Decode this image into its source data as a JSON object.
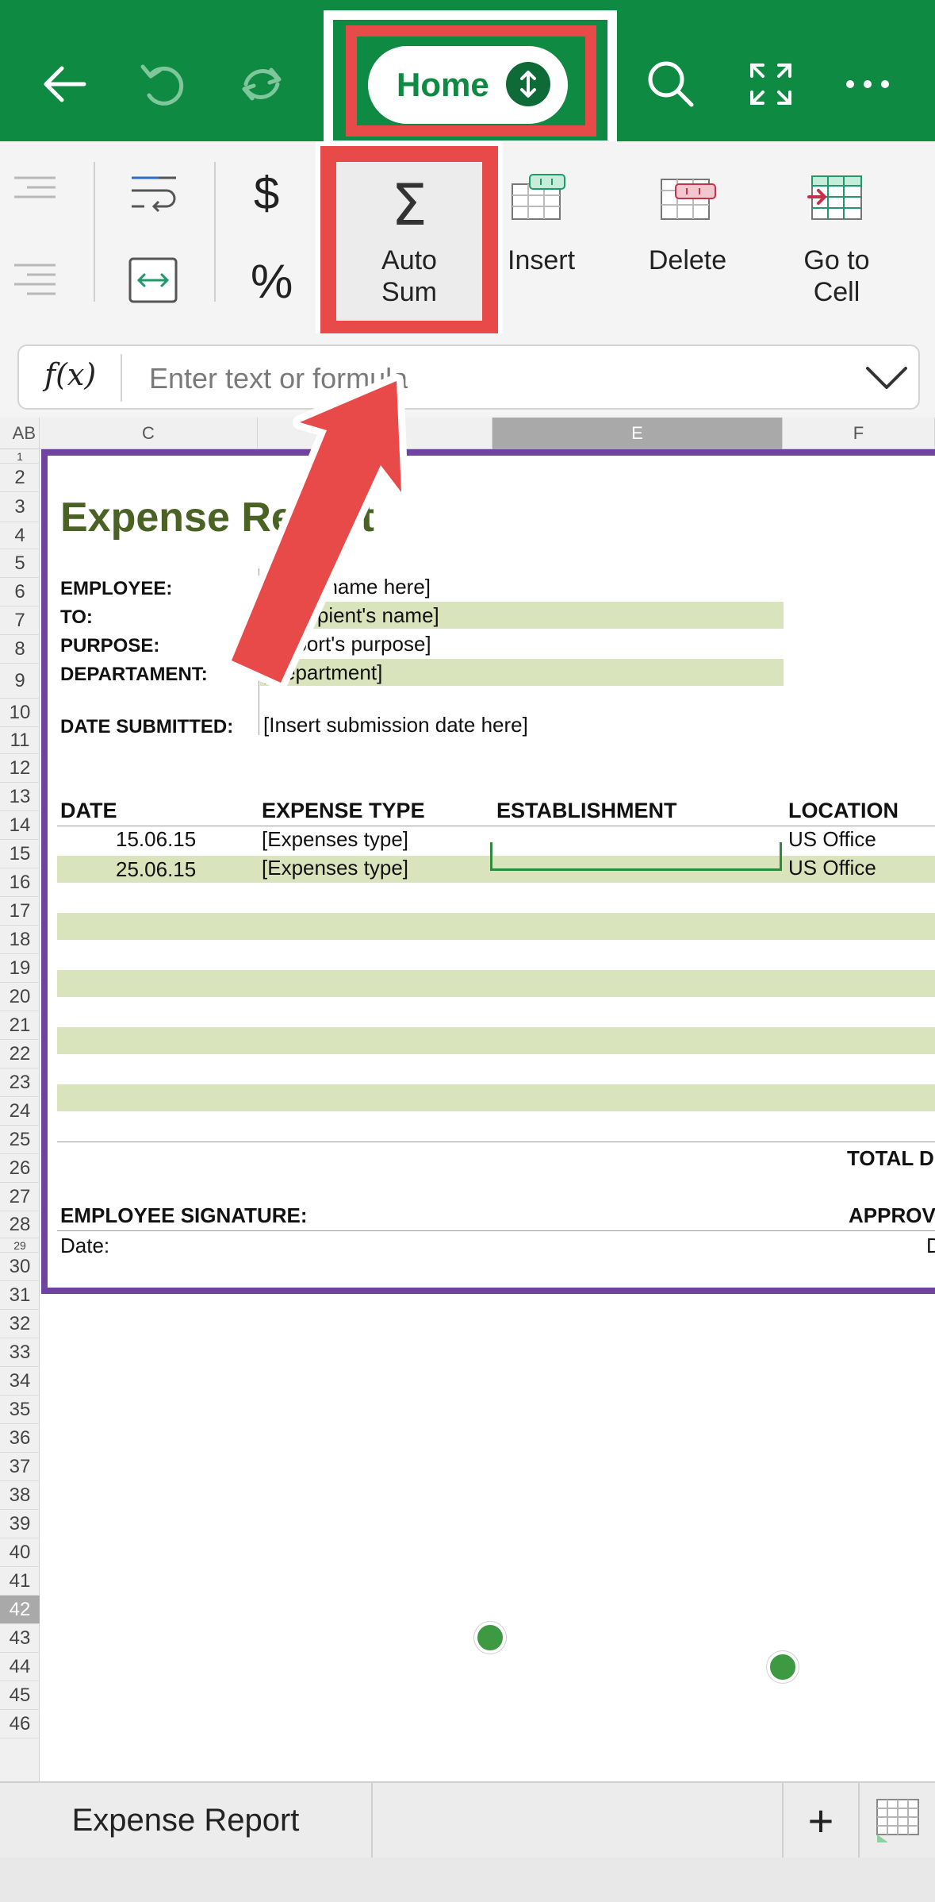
{
  "topbar": {
    "back_icon": "back-arrow-icon",
    "undo_icon": "undo-icon",
    "redo_icon": "redo-icon",
    "home_label": "Home",
    "search_icon": "search-icon",
    "fullscreen_icon": "fullscreen-icon",
    "more_icon": "more-icon",
    "color": "#0e8a43"
  },
  "ribbon": {
    "autosum_label": "Auto\nSum",
    "insert_label": "Insert",
    "delete_label": "Delete",
    "goto_label": "Go to\nCell"
  },
  "formula": {
    "fx_label": "f(x)",
    "placeholder": "Enter text or formula"
  },
  "columns": [
    "A",
    "B",
    "C",
    "E",
    "F"
  ],
  "rows": [
    "1",
    "2",
    "3",
    "4",
    "5",
    "6",
    "7",
    "8",
    "9",
    "10",
    "11",
    "12",
    "13",
    "14",
    "15",
    "16",
    "17",
    "18",
    "19",
    "20",
    "21",
    "22",
    "23",
    "24",
    "25",
    "26",
    "27",
    "28",
    "29",
    "30",
    "31",
    "32",
    "33",
    "34",
    "35",
    "36",
    "37",
    "38",
    "39",
    "40",
    "41",
    "42",
    "43",
    "44",
    "45",
    "46"
  ],
  "report": {
    "title": "Expense Report",
    "employee_label": "EMPLOYEE:",
    "employee_value": "[Insert name here]",
    "to_label": "TO:",
    "to_value": "[Recepient's name]",
    "purpose_label": "PURPOSE:",
    "purpose_value": "[Report's purpose]",
    "department_label": "DEPARTAMENT:",
    "department_value": "[Department]",
    "date_submitted_label": "DATE SUBMITTED:",
    "date_submitted_value": "[Insert submission date here]",
    "headers": [
      "DATE",
      "EXPENSE TYPE",
      "ESTABLISHMENT",
      "LOCATION"
    ],
    "entries": [
      {
        "date": "15.06.15",
        "type": "[Expenses type]",
        "location": "US Office"
      },
      {
        "date": "25.06.15",
        "type": "[Expenses type]",
        "location": "US Office"
      }
    ],
    "total_label": "TOTAL D",
    "signature_label": "EMPLOYEE SIGNATURE:",
    "approval_label": "APPROV",
    "date_label": "Date:",
    "date_right_label": "D"
  },
  "tabs": {
    "sheet_name": "Expense Report",
    "add_label": "+"
  },
  "annotation_color": "#e84a4a"
}
